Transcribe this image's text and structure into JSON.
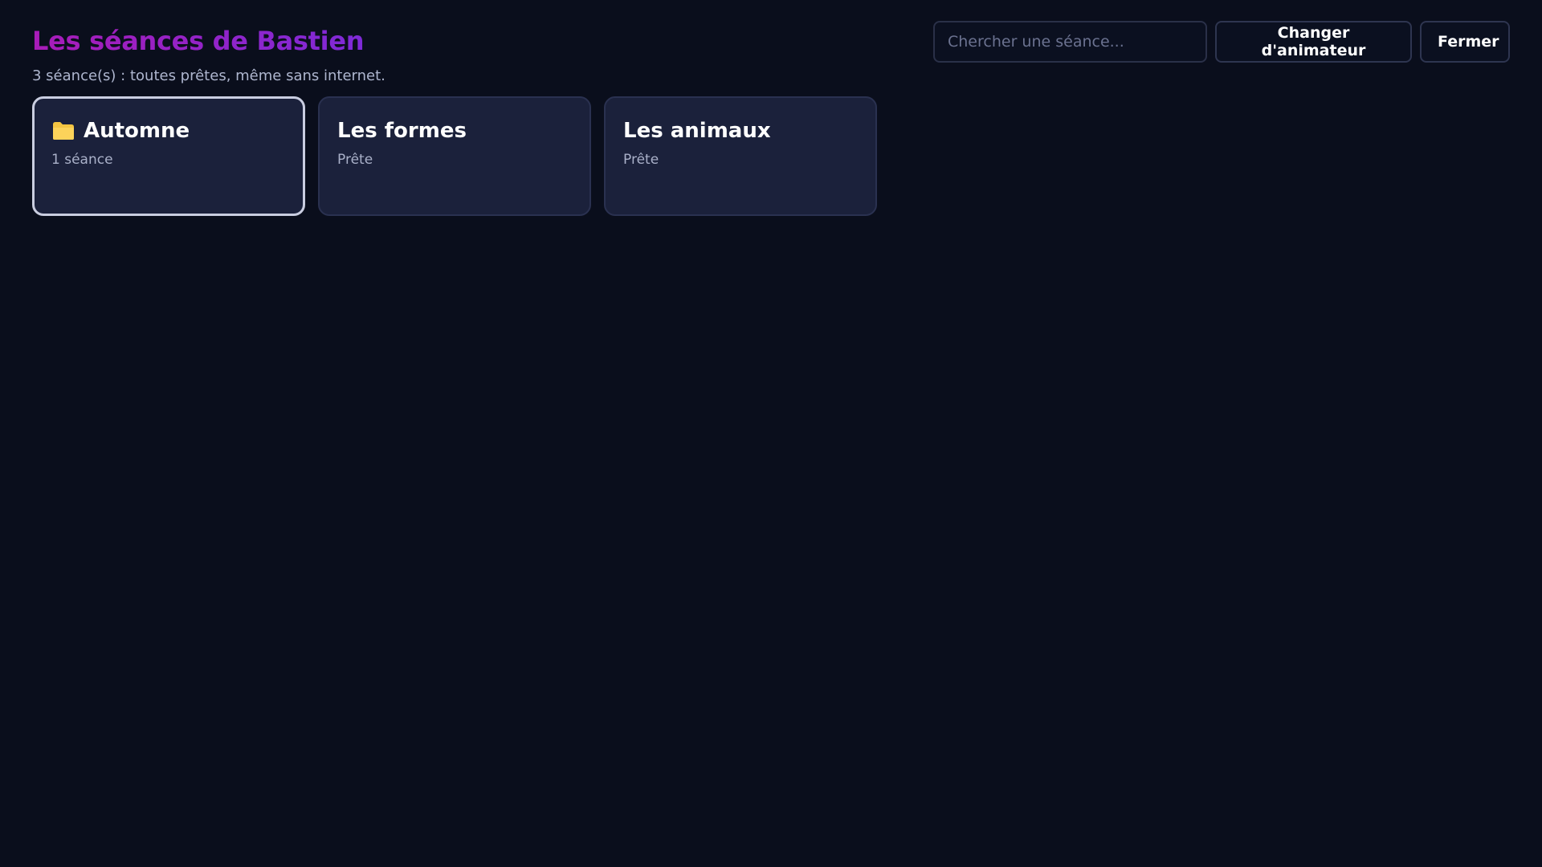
{
  "header": {
    "title": "Les séances de Bastien",
    "subtitle": "3 séance(s) : toutes prêtes, même sans internet."
  },
  "toolbar": {
    "search_placeholder": "Chercher une séance...",
    "search_value": "",
    "change_label": "Changer d'animateur",
    "close_label": "Fermer"
  },
  "cards": [
    {
      "title": "Automne",
      "subtitle": "1 séance",
      "icon": "folder-icon",
      "selected": true
    },
    {
      "title": "Les formes",
      "subtitle": "Prête",
      "selected": false
    },
    {
      "title": "Les animaux",
      "subtitle": "Prête",
      "selected": false
    }
  ],
  "colors": {
    "background": "#0a0e1c",
    "card": "#1b213b",
    "title_gradient_start": "#a91cb8",
    "title_gradient_end": "#7c2bd9",
    "folder": "#f5c542"
  }
}
